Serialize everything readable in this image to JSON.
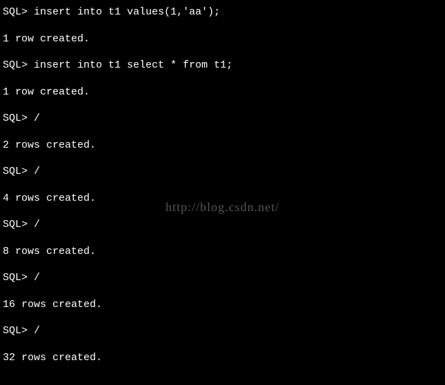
{
  "terminal": {
    "lines": [
      {
        "type": "cmd",
        "prompt": "SQL>",
        "text": " insert into t1 values(1,'aa');"
      },
      {
        "type": "blank"
      },
      {
        "type": "out",
        "text": "1 row created."
      },
      {
        "type": "blank"
      },
      {
        "type": "cmd",
        "prompt": "SQL>",
        "text": " insert into t1 select * from t1;"
      },
      {
        "type": "blank"
      },
      {
        "type": "out",
        "text": "1 row created."
      },
      {
        "type": "blank"
      },
      {
        "type": "cmd",
        "prompt": "SQL>",
        "text": " /"
      },
      {
        "type": "blank"
      },
      {
        "type": "out",
        "text": "2 rows created."
      },
      {
        "type": "blank"
      },
      {
        "type": "cmd",
        "prompt": "SQL>",
        "text": " /"
      },
      {
        "type": "blank"
      },
      {
        "type": "out",
        "text": "4 rows created."
      },
      {
        "type": "blank"
      },
      {
        "type": "cmd",
        "prompt": "SQL>",
        "text": " /"
      },
      {
        "type": "blank"
      },
      {
        "type": "out",
        "text": "8 rows created."
      },
      {
        "type": "blank"
      },
      {
        "type": "cmd",
        "prompt": "SQL>",
        "text": " /"
      },
      {
        "type": "blank"
      },
      {
        "type": "out",
        "text": "16 rows created."
      },
      {
        "type": "blank"
      },
      {
        "type": "cmd",
        "prompt": "SQL>",
        "text": " /"
      },
      {
        "type": "blank"
      },
      {
        "type": "out",
        "text": "32 rows created."
      }
    ]
  },
  "watermark": "http://blog.csdn.net/"
}
